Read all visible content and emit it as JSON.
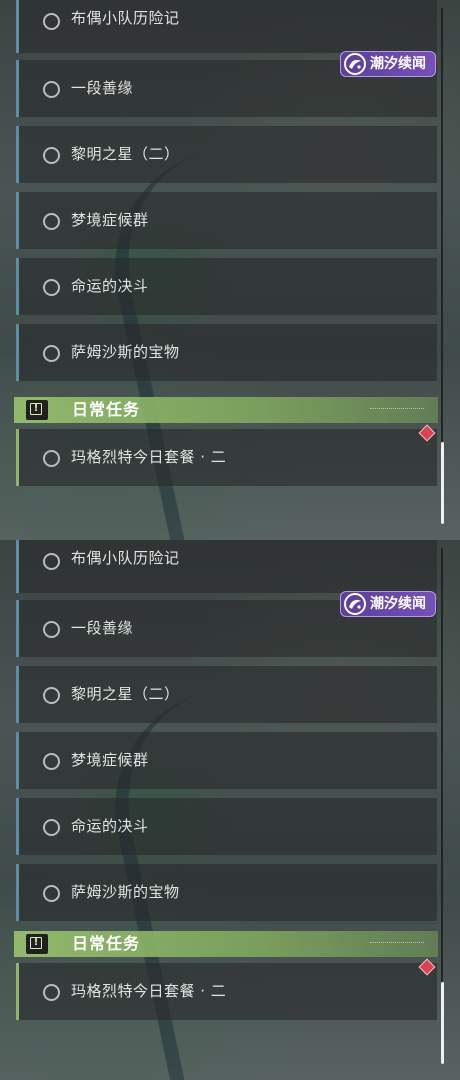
{
  "panels": [
    {
      "quests": [
        {
          "title": "布偶小队历险记"
        },
        {
          "title": "一段善缘"
        },
        {
          "title": "黎明之星（二）"
        },
        {
          "title": "梦境症候群"
        },
        {
          "title": "命运的决斗"
        },
        {
          "title": "萨姆沙斯的宝物"
        }
      ],
      "event_tag": {
        "label": "潮汐续闻",
        "icon": "tide-logo-icon"
      },
      "daily_section": {
        "label": "日常任务",
        "icon": "exclamation-icon"
      },
      "daily_quests": [
        {
          "title": "玛格烈特今日套餐 · 二"
        }
      ],
      "scroll_position": 0.85
    },
    {
      "quests": [
        {
          "title": "布偶小队历险记"
        },
        {
          "title": "一段善缘"
        },
        {
          "title": "黎明之星（二）"
        },
        {
          "title": "梦境症候群"
        },
        {
          "title": "命运的决斗"
        },
        {
          "title": "萨姆沙斯的宝物"
        }
      ],
      "event_tag": {
        "label": "潮汐续闻",
        "icon": "tide-logo-icon"
      },
      "daily_section": {
        "label": "日常任务",
        "icon": "exclamation-icon"
      },
      "daily_quests": [
        {
          "title": "玛格烈特今日套餐 · 二"
        }
      ],
      "scroll_position": 0.85
    }
  ],
  "colors": {
    "story_quest_accent": "#5b8fa3",
    "daily_accent": "#8fb46b",
    "event_tag": "#6a48aa",
    "new_marker": "#d94452"
  }
}
